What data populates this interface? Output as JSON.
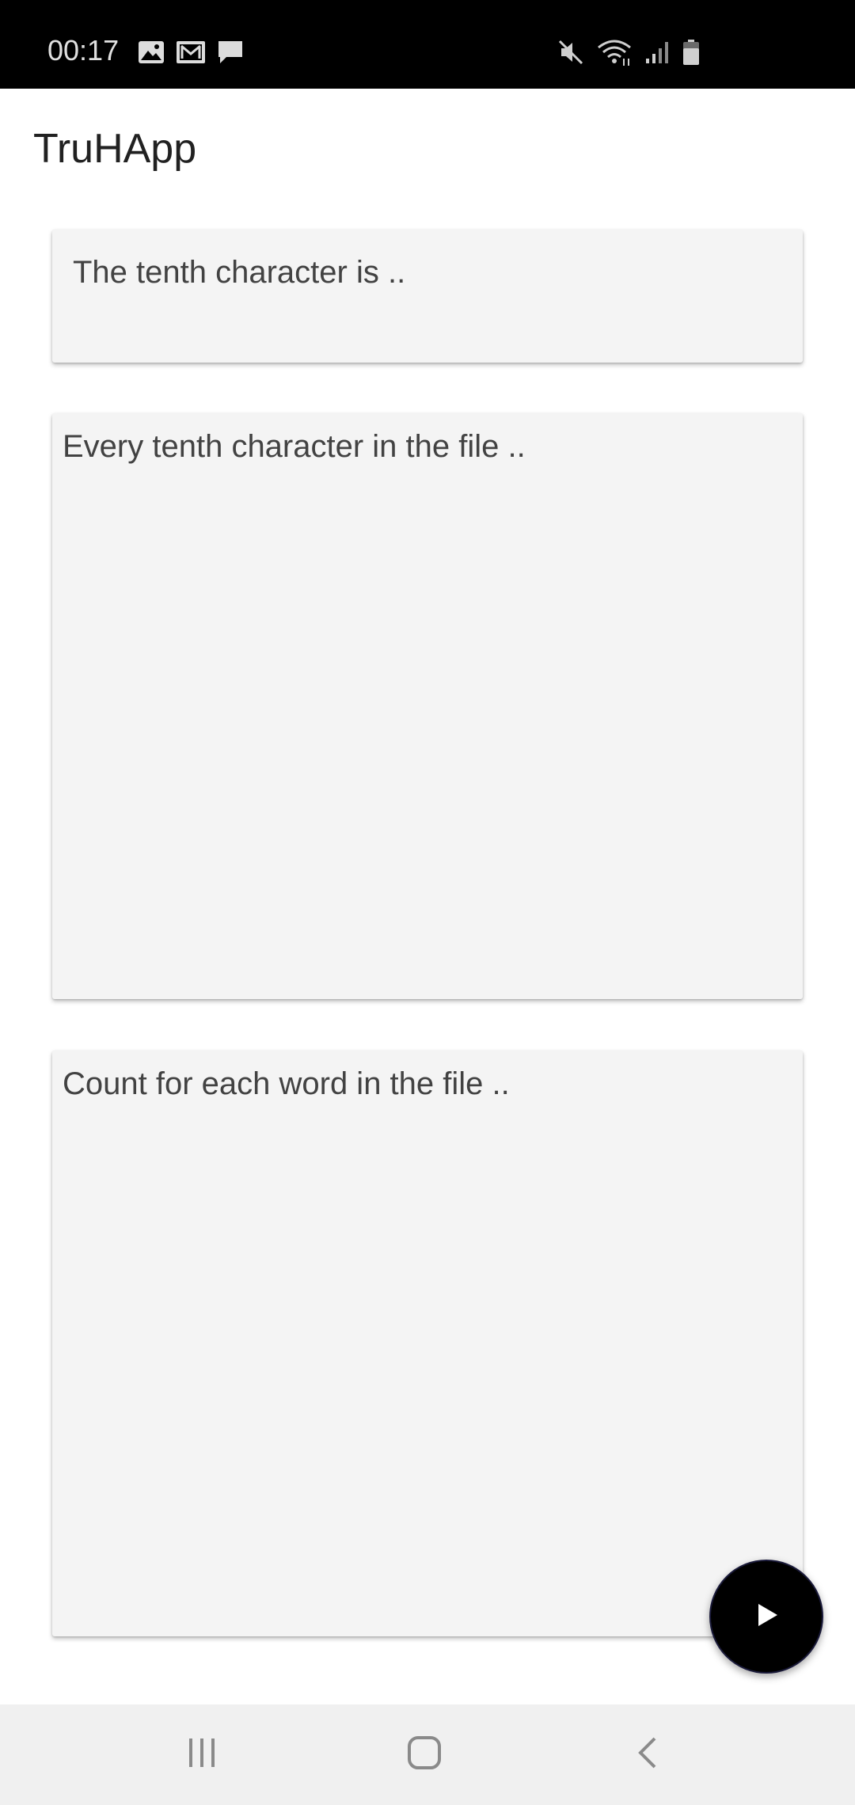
{
  "status_bar": {
    "time": "00:17",
    "left_icons": [
      "gallery-icon",
      "gmail-icon",
      "message-icon"
    ],
    "right_icons": [
      "mute-icon",
      "wifi-icon",
      "signal-icon",
      "battery-icon"
    ]
  },
  "app": {
    "title": "TruHApp"
  },
  "cards": {
    "tenth_character": "The tenth character is ..",
    "every_tenth_character": "Every tenth character in the file ..",
    "word_count": "Count for each word in the file .."
  },
  "fab": {
    "icon": "play-icon"
  },
  "nav_bar": {
    "icons": [
      "recents-icon",
      "home-icon",
      "back-icon"
    ]
  },
  "colors": {
    "status_bar": "#000000",
    "card_background": "#f4f4f4",
    "fab": "#000000",
    "nav_bar": "#f0f0f0"
  }
}
